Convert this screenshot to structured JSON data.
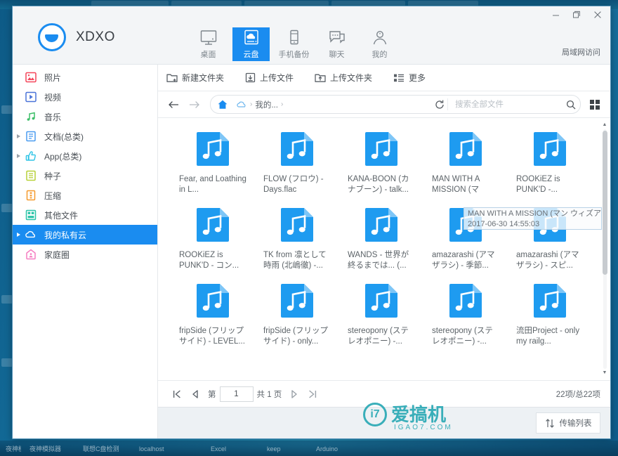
{
  "window": {
    "controls": {
      "minimize": "—",
      "maximize": "❐",
      "close": "✕"
    }
  },
  "header": {
    "brand_name": "XDXO",
    "lan_access": "局域网访问",
    "tabs": [
      {
        "label": "桌面",
        "icon": "monitor-icon",
        "active": false
      },
      {
        "label": "云盘",
        "icon": "cloud-drive-icon",
        "active": true
      },
      {
        "label": "手机备份",
        "icon": "phone-backup-icon",
        "active": false
      },
      {
        "label": "聊天",
        "icon": "chat-icon",
        "active": false
      },
      {
        "label": "我的",
        "icon": "user-icon",
        "active": false
      }
    ]
  },
  "sidebar": {
    "items": [
      {
        "label": "照片",
        "icon": "photo-icon",
        "color": "#f4455a",
        "arrow": false,
        "selected": false
      },
      {
        "label": "视频",
        "icon": "video-icon",
        "color": "#4a73d8",
        "arrow": false,
        "selected": false
      },
      {
        "label": "音乐",
        "icon": "music-icon",
        "color": "#3fbf6a",
        "arrow": false,
        "selected": false
      },
      {
        "label": "文档(总类)",
        "icon": "document-icon",
        "color": "#4a9cf0",
        "arrow": true,
        "selected": false
      },
      {
        "label": "App(总类)",
        "icon": "app-icon",
        "color": "#2ec4e6",
        "arrow": true,
        "selected": false
      },
      {
        "label": "种子",
        "icon": "seed-icon",
        "color": "#b7d138",
        "arrow": false,
        "selected": false
      },
      {
        "label": "压缩",
        "icon": "archive-icon",
        "color": "#f59a2e",
        "arrow": false,
        "selected": false
      },
      {
        "label": "其他文件",
        "icon": "other-files-icon",
        "color": "#2bc4a8",
        "arrow": false,
        "selected": false
      },
      {
        "label": "我的私有云",
        "icon": "private-cloud-icon",
        "color": "#ffffff",
        "arrow": true,
        "selected": true
      },
      {
        "label": "家庭圈",
        "icon": "family-circle-icon",
        "color": "#f57fc2",
        "arrow": false,
        "selected": false
      }
    ]
  },
  "toolbar": {
    "buttons": [
      {
        "label": "新建文件夹",
        "icon": "new-folder-icon"
      },
      {
        "label": "上传文件",
        "icon": "upload-file-icon"
      },
      {
        "label": "上传文件夹",
        "icon": "upload-folder-icon"
      },
      {
        "label": "更多",
        "icon": "more-icon"
      }
    ]
  },
  "navbar": {
    "back": "←",
    "forward": "→",
    "crumbs": [
      "我的..."
    ],
    "refresh_icon": "refresh-icon",
    "search_placeholder": "搜索全部文件",
    "search_value": "",
    "view_toggle_icon": "grid-view-icon"
  },
  "files": [
    {
      "name": "Fear, and Loathing in L...",
      "type": "music"
    },
    {
      "name": "FLOW (フロウ) - Days.flac",
      "type": "music"
    },
    {
      "name": "KANA-BOON (カナブーン) - talk...",
      "type": "music"
    },
    {
      "name": "MAN WITH A MISSION (マ",
      "type": "music"
    },
    {
      "name": "ROOKiEZ is PUNK'D -...",
      "type": "music"
    },
    {
      "name": "ROOKiEZ is PUNK'D - コン...",
      "type": "music"
    },
    {
      "name": "TK from 凛として時雨 (北嶋徹) -...",
      "type": "music"
    },
    {
      "name": "WANDS - 世界が終るまでは... (...",
      "type": "music"
    },
    {
      "name": "amazarashi (アマザラシ) - 季節...",
      "type": "music"
    },
    {
      "name": "amazarashi (アマザラシ) - スピ...",
      "type": "music"
    },
    {
      "name": "fripSide (フリップサイド) - LEVEL...",
      "type": "music"
    },
    {
      "name": "fripSide (フリップサイド) - only...",
      "type": "music"
    },
    {
      "name": "stereopony (ステレオポニー) -...",
      "type": "music"
    },
    {
      "name": "stereopony (ステレオポニー) -...",
      "type": "music"
    },
    {
      "name": "流田Project - only my railg...",
      "type": "music"
    }
  ],
  "tooltip": {
    "title": "MAN WITH A MISSION (マン ウィズア",
    "date": "2017-06-30 14:55:03"
  },
  "pagination": {
    "first": "|◀",
    "prev": "◀",
    "label_prefix": "第",
    "page_value": "1",
    "label_suffix": "共 1 页",
    "next": "▶",
    "last": "▶|",
    "count": "22项/总22项"
  },
  "footer": {
    "watermark_text": "爱搞机",
    "watermark_sub": "IGAO7.COM",
    "watermark_mark": "i7",
    "transfer_label": "传输列表",
    "transfer_icon": "transfer-icon"
  },
  "background": {
    "tabs": [
      "",
      "",
      "",
      "",
      ""
    ],
    "taskbar": [
      "夜神模拟器",
      "联想C盘检测",
      "localhost",
      "Excel",
      "keep",
      "Arduino"
    ]
  },
  "colors": {
    "accent": "#1a8cf0",
    "header_bg": "#f3f5f7",
    "watermark": "#2aa9b5"
  }
}
